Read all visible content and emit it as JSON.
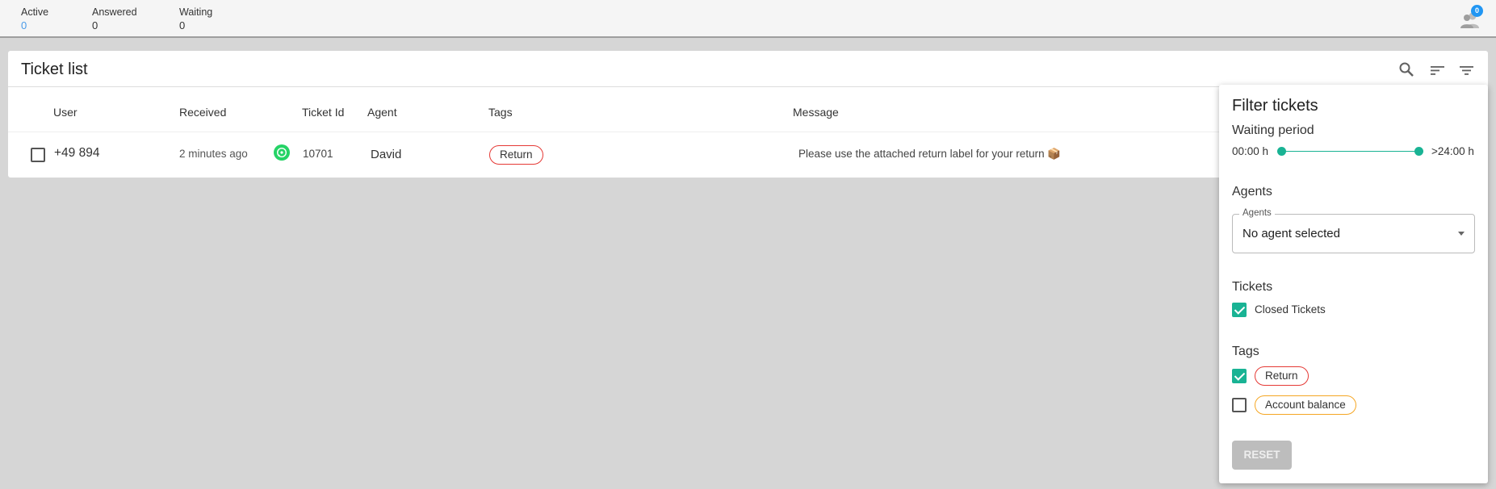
{
  "topbar": {
    "active_label": "Active",
    "active_value": "0",
    "answered_label": "Answered",
    "answered_value": "0",
    "waiting_label": "Waiting",
    "waiting_value": "0",
    "users_badge": "0"
  },
  "ticket_list": {
    "title": "Ticket list",
    "columns": [
      "User",
      "Received",
      "Ticket Id",
      "Agent",
      "Tags",
      "Message"
    ],
    "rows": [
      {
        "user": "+49 894",
        "received": "2 minutes ago",
        "channel": "whatsapp-icon",
        "ticket_id": "10701",
        "agent": "David",
        "tag": "Return",
        "message": "Please use the attached return label for your return 📦"
      }
    ]
  },
  "filter_panel": {
    "title": "Filter tickets",
    "waiting_period": {
      "label": "Waiting period",
      "min": "00:00 h",
      "max": ">24:00 h"
    },
    "agents": {
      "label": "Agents",
      "field_label": "Agents",
      "value": "No agent selected"
    },
    "tickets": {
      "label": "Tickets",
      "closed_label": "Closed Tickets",
      "closed_checked": true
    },
    "tags": {
      "label": "Tags",
      "items": [
        {
          "label": "Return",
          "checked": true,
          "color": "#e53935"
        },
        {
          "label": "Account balance",
          "checked": false,
          "color": "#f5a623"
        }
      ]
    },
    "reset_label": "RESET"
  },
  "colors": {
    "accent": "#19b394",
    "active_count": "#4a9be8",
    "whatsapp": "#25d366"
  }
}
